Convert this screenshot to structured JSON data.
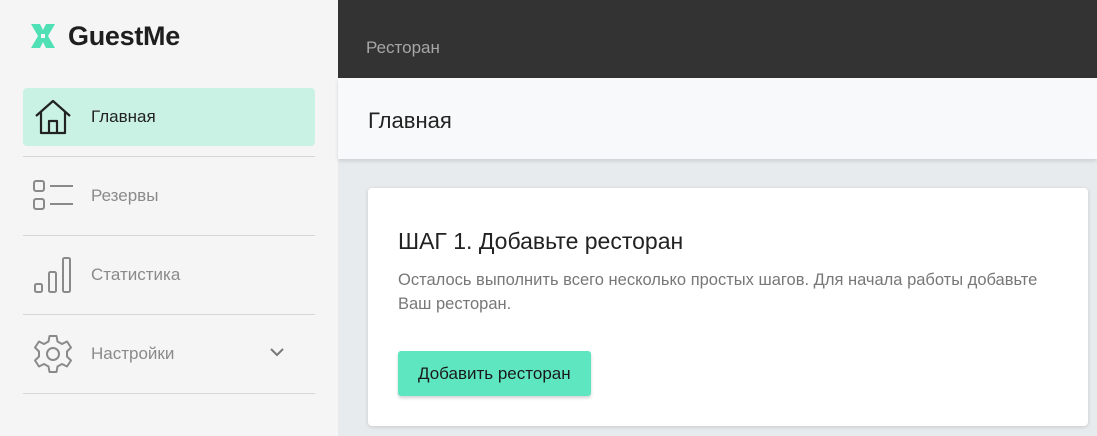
{
  "app": {
    "name": "GuestMe",
    "logo_icon": "x-logo-icon",
    "accent": "#5ee6c0",
    "active_bg": "#c9f2e4"
  },
  "sidebar": {
    "items": [
      {
        "label": "Главная",
        "icon": "home-icon",
        "active": true
      },
      {
        "label": "Резервы",
        "icon": "list-icon",
        "active": false
      },
      {
        "label": "Статистика",
        "icon": "bar-chart-icon",
        "active": false
      },
      {
        "label": "Настройки",
        "icon": "gear-icon",
        "active": false,
        "expandable": true
      }
    ]
  },
  "topbar": {
    "title": "Ресторан"
  },
  "page": {
    "title": "Главная"
  },
  "card": {
    "title": "ШАГ 1. Добавьте ресторан",
    "text": "Осталось выполнить всего несколько простых шагов. Для начала работы добавьте Ваш ресторан.",
    "button_label": "Добавить ресторан"
  }
}
